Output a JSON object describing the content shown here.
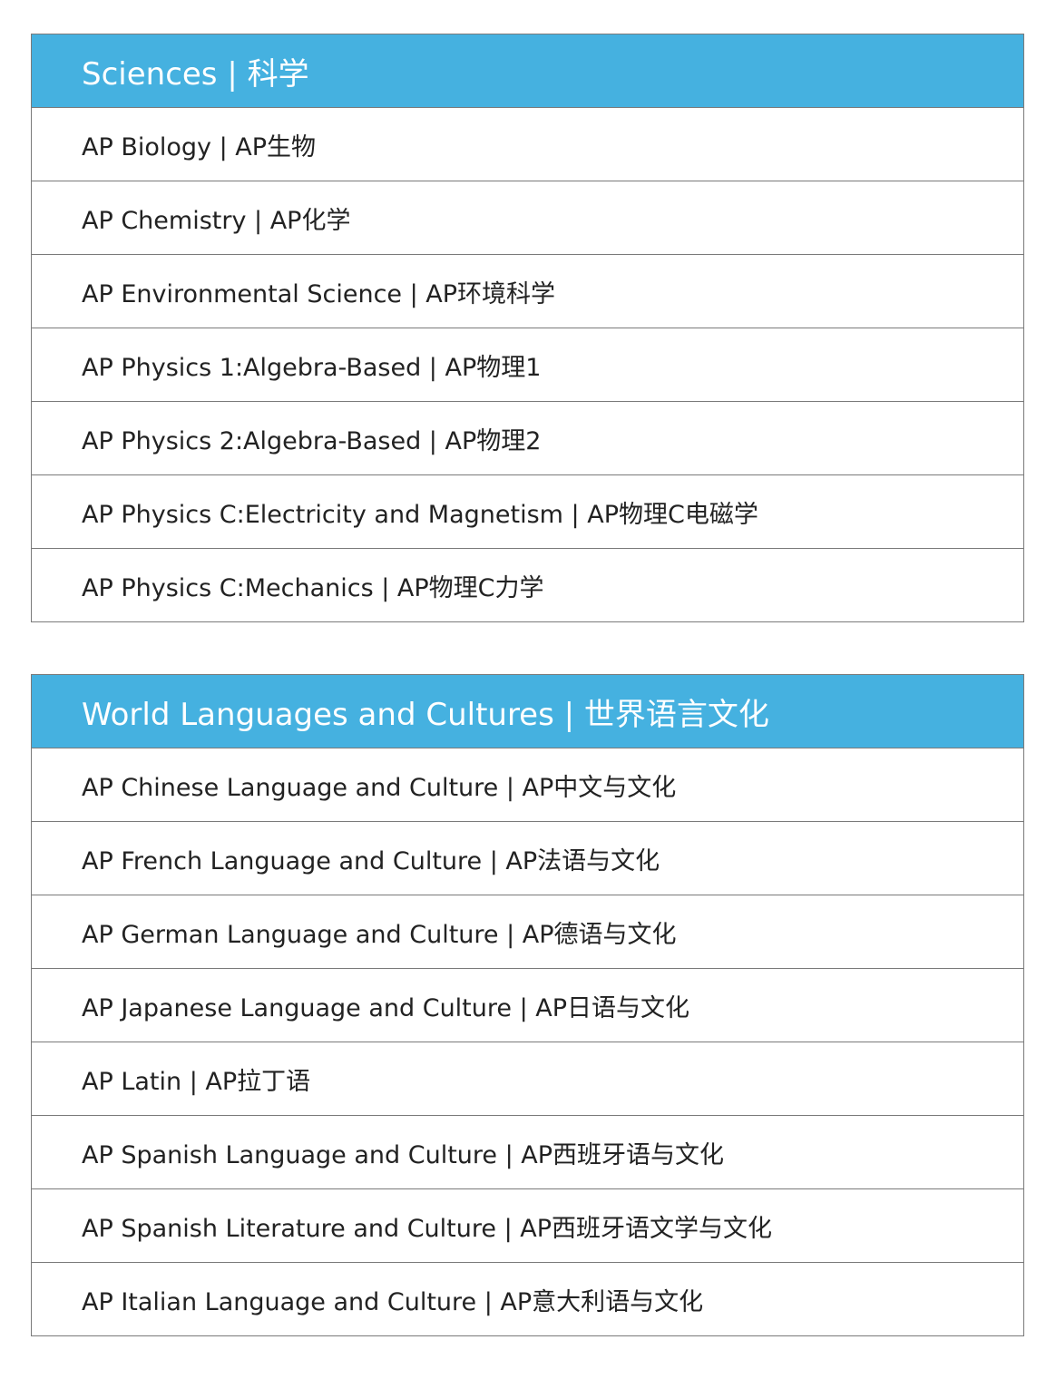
{
  "sections": [
    {
      "title": "Sciences | 科学",
      "items": [
        "AP Biology | AP生物",
        "AP Chemistry | AP化学",
        "AP Environmental Science | AP环境科学",
        "AP Physics 1:Algebra-Based | AP物理1",
        "AP Physics 2:Algebra-Based | AP物理2",
        "AP Physics C:Electricity and Magnetism | AP物理C电磁学",
        "AP Physics C:Mechanics | AP物理C力学"
      ]
    },
    {
      "title": "World Languages and Cultures | 世界语言文化",
      "items": [
        "AP Chinese Language and Culture | AP中文与文化",
        "AP French Language and Culture | AP法语与文化",
        "AP German Language and Culture | AP德语与文化",
        "AP Japanese Language and Culture | AP日语与文化",
        "AP Latin | AP拉丁语",
        "AP Spanish Language and Culture | AP西班牙语与文化",
        "AP Spanish Literature and Culture | AP西班牙语文学与文化",
        "AP Italian Language and Culture | AP意大利语与文化"
      ]
    }
  ],
  "colors": {
    "header_bg": "#45b1e0",
    "header_text": "#ffffff",
    "border": "#7a7a7a",
    "row_text": "#222222"
  }
}
